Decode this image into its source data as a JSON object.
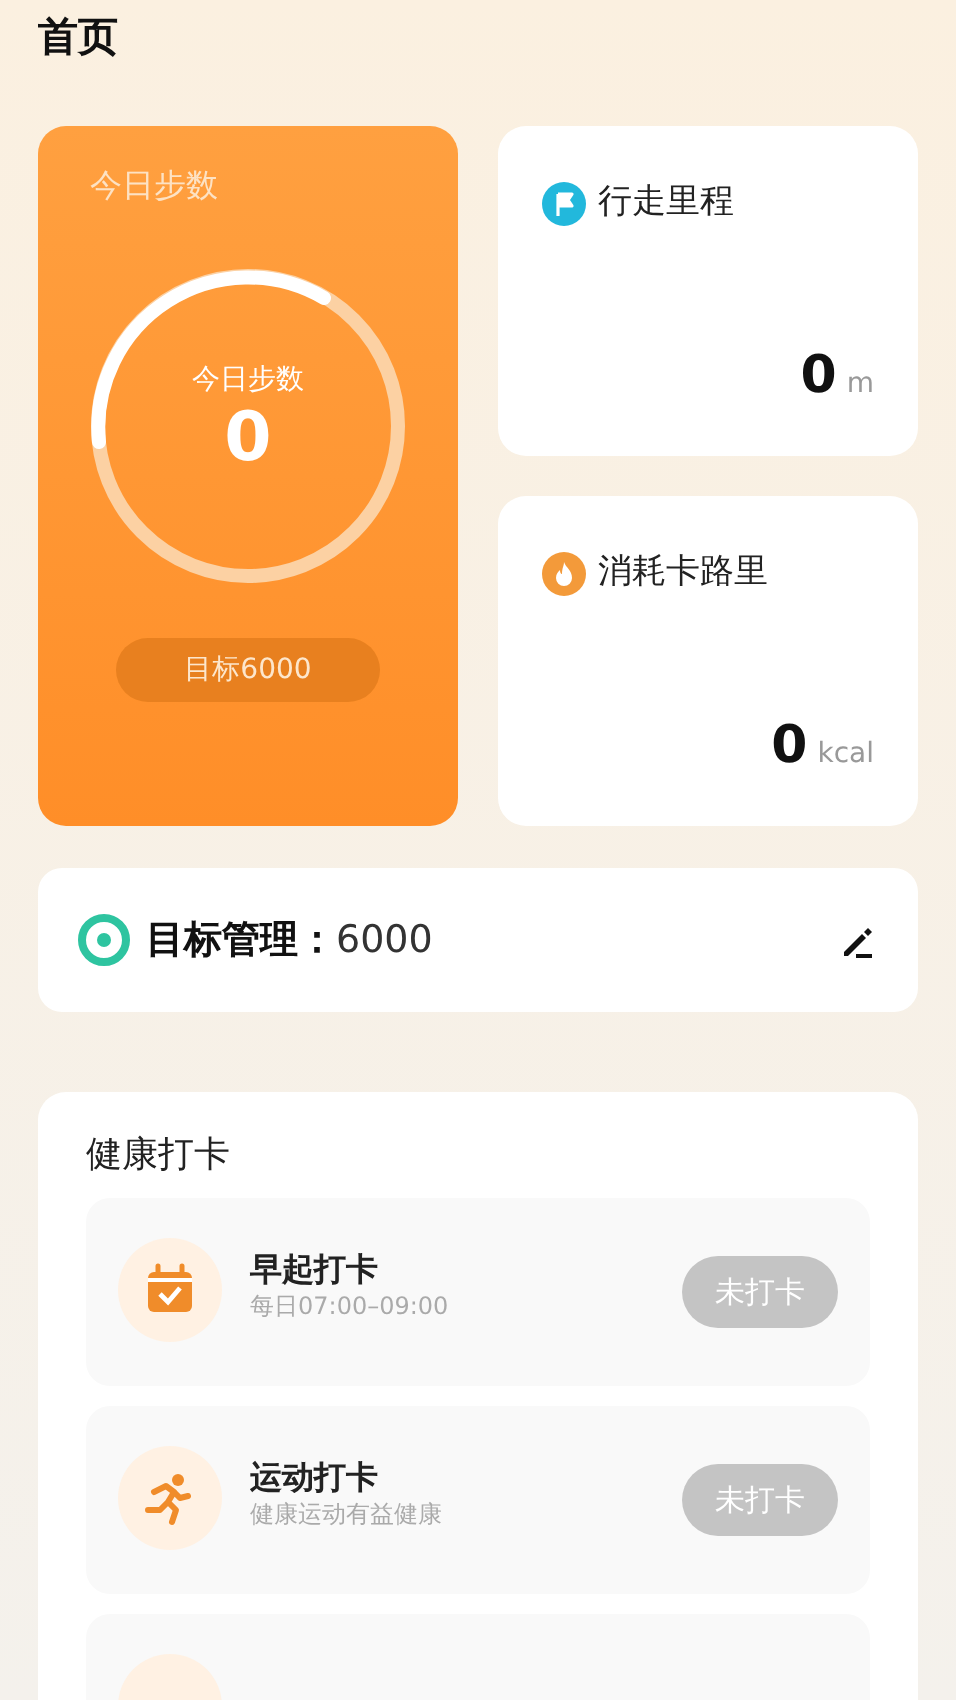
{
  "page_title": "首页",
  "steps_card": {
    "title": "今日步数",
    "ring_label": "今日步数",
    "steps": "0",
    "goal": "目标6000"
  },
  "stats": [
    {
      "kind": "distance",
      "label": "行走里程",
      "value": "0",
      "unit": "m"
    },
    {
      "kind": "calories",
      "label": "消耗卡路里",
      "value": "0",
      "unit": "kcal"
    }
  ],
  "goal_management": {
    "label": "目标管理：",
    "value": "6000"
  },
  "checkin": {
    "title": "健康打卡",
    "items": [
      {
        "kind": "wake",
        "title": "早起打卡",
        "subtitle": "每日07:00–09:00",
        "button": "未打卡"
      },
      {
        "kind": "exercise",
        "title": "运动打卡",
        "subtitle": "健康运动有益健康",
        "button": "未打卡"
      },
      {
        "kind": "cut_off"
      }
    ]
  }
}
